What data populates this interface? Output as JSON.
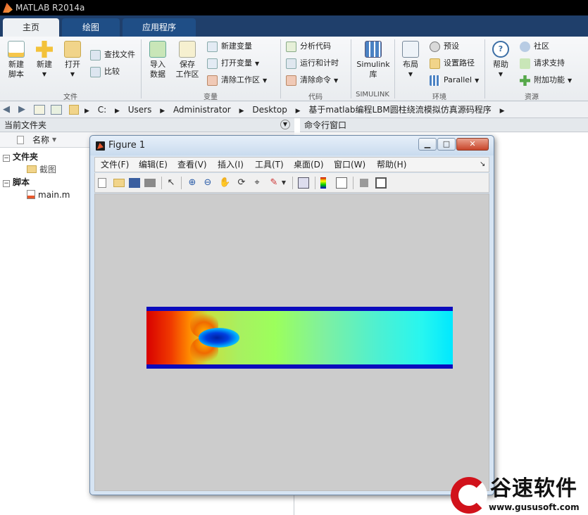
{
  "app": {
    "title": "MATLAB R2014a"
  },
  "tabs": [
    "主页",
    "绘图",
    "应用程序"
  ],
  "ribbon": {
    "file": {
      "new_script": "新建\n脚本",
      "new": "新建",
      "open": "打开",
      "find_files": "查找文件",
      "compare": "比较",
      "group": "文件"
    },
    "variable": {
      "import": "导入\n数据",
      "save_ws": "保存\n工作区",
      "new_var": "新建变量",
      "open_var": "打开变量",
      "clear_ws": "清除工作区",
      "group": "变量"
    },
    "code": {
      "analyze": "分析代码",
      "run_time": "运行和计时",
      "clear_cmd": "清除命令",
      "group": "代码"
    },
    "simulink": {
      "lib": "Simulink\n库",
      "group": "SIMULINK"
    },
    "env": {
      "layout": "布局",
      "prefs": "预设",
      "set_path": "设置路径",
      "parallel": "Parallel",
      "group": "环境"
    },
    "resources": {
      "help": "帮助",
      "community": "社区",
      "support": "请求支持",
      "addons": "附加功能",
      "group": "资源"
    }
  },
  "path": {
    "crumbs": [
      "C:",
      "Users",
      "Administrator",
      "Desktop",
      "基于matlab编程LBM圆柱绕流模拟仿真源码程序"
    ]
  },
  "left_pane": {
    "header": "当前文件夹",
    "col_name": "名称",
    "folder_group": "文件夹",
    "folder_item": "截图",
    "script_group": "脚本",
    "script_item": "main.m"
  },
  "right_pane": {
    "header": "命令行窗口"
  },
  "figure": {
    "title": "Figure 1",
    "menu": [
      "文件(F)",
      "编辑(E)",
      "查看(V)",
      "插入(I)",
      "工具(T)",
      "桌面(D)",
      "窗口(W)",
      "帮助(H)"
    ]
  },
  "watermark": {
    "title": "谷速软件",
    "url": "www.gususoft.com"
  },
  "colors": {
    "tabbar": "#1f3f6b",
    "accent": "#d1121b"
  }
}
